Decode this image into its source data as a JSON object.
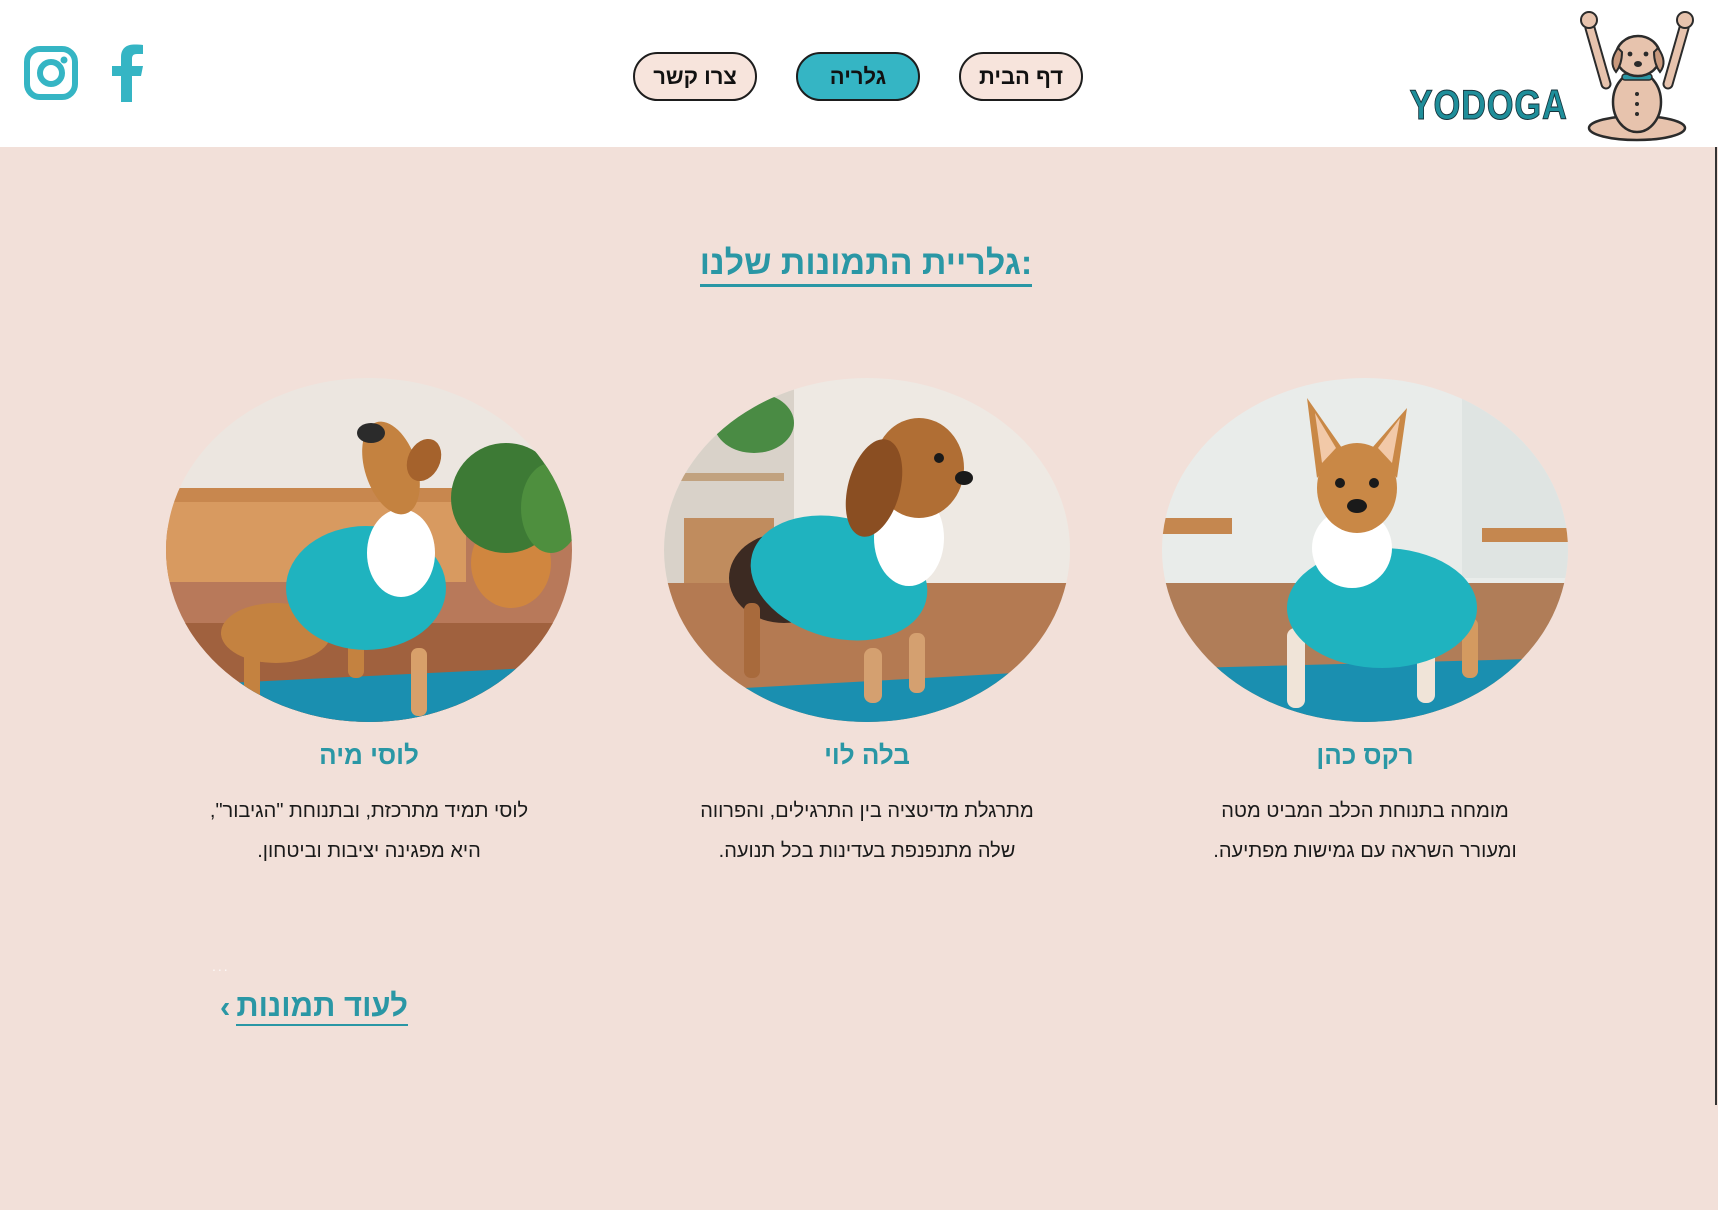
{
  "header": {
    "brand": "YODOGA",
    "nav": [
      {
        "label": "צרו קשר",
        "active": false
      },
      {
        "label": "גלריה",
        "active": true
      },
      {
        "label": "דף הבית",
        "active": false
      }
    ],
    "social": [
      "instagram-icon",
      "facebook-icon"
    ]
  },
  "gallery": {
    "title": "גלריית התמונות שלנו:",
    "cards": [
      {
        "name": "רקס כהן",
        "line1": "מומחה בתנוחת הכלב המביט מטה",
        "line2": "ומעורר השראה עם גמישות מפתיעה."
      },
      {
        "name": "בלה לוי",
        "line1": "מתרגלת מדיטציה בין התרגילים, והפרווה",
        "line2": "שלה מתנפנפת בעדינות בכל תנועה."
      },
      {
        "name": "לוסי מיה",
        "line1": "לוסי תמיד מתרכזת, ובתנוחת \"הגיבור\",",
        "line2": "היא מפגינה יציבות וביטחון."
      }
    ],
    "dots": "...",
    "more_label": "לעוד תמונות",
    "more_chevron": "‹"
  },
  "colors": {
    "accent": "#2a97a5",
    "active_nav": "#35b5c4",
    "background": "#f2e0d9",
    "shirt": "#1fb3bf",
    "mat": "#1a8fb0"
  }
}
